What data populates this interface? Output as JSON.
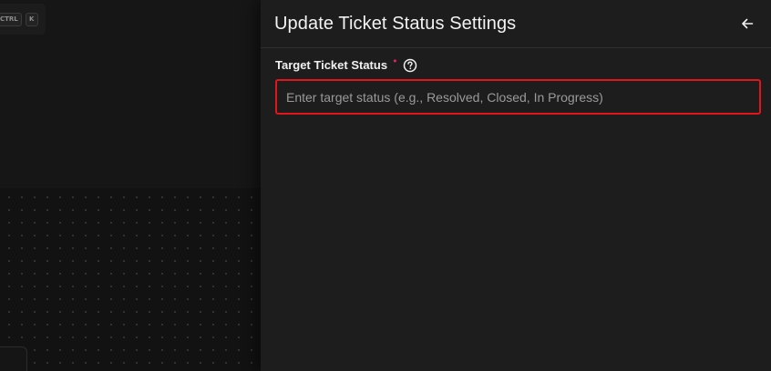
{
  "shortcut": {
    "keys": [
      "CTRL",
      "K"
    ]
  },
  "panel": {
    "title": "Update Ticket Status Settings",
    "back_icon": "arrow-left-icon"
  },
  "field": {
    "label": "Target Ticket Status",
    "required_marker": "•",
    "help_icon": "question-circle-icon",
    "value": "",
    "placeholder": "Enter target status (e.g., Resolved, Closed, In Progress)"
  },
  "colors": {
    "panel_bg": "#1d1d1d",
    "canvas_bg": "#131313",
    "required": "#e0245e",
    "highlight_border": "#e3141b"
  }
}
